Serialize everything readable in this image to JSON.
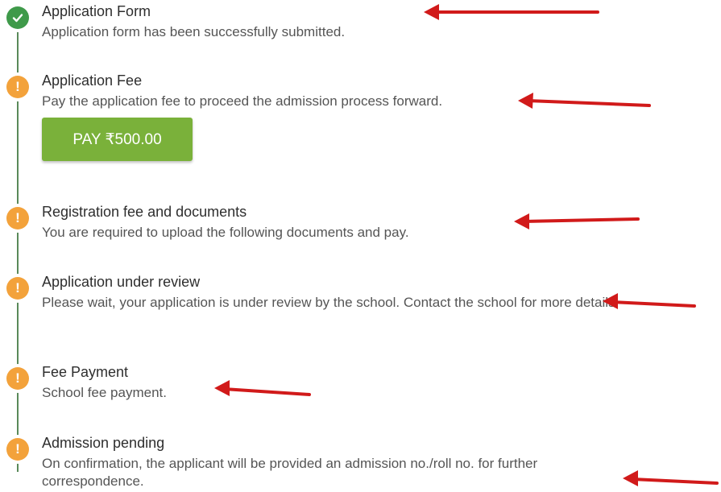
{
  "steps": [
    {
      "status": "done",
      "icon": "check-circle-icon",
      "title": "Application Form",
      "description": "Application form has been successfully submitted."
    },
    {
      "status": "pending",
      "icon": "exclamation-circle-icon",
      "title": "Application Fee",
      "description": "Pay the application fee to proceed the admission process forward."
    },
    {
      "status": "pending",
      "icon": "exclamation-circle-icon",
      "title": "Registration fee and documents",
      "description": "You are required to upload the following documents and pay."
    },
    {
      "status": "pending",
      "icon": "exclamation-circle-icon",
      "title": "Application under review",
      "description": "Please wait, your application is under review by the school. Contact the school for more details."
    },
    {
      "status": "pending",
      "icon": "exclamation-circle-icon",
      "title": "Fee Payment",
      "description": "School fee payment."
    },
    {
      "status": "pending",
      "icon": "exclamation-circle-icon",
      "title": "Admission pending",
      "description": "On confirmation, the applicant will be provided an admission no./roll no. for further correspondence."
    }
  ],
  "pay_button": {
    "label": "PAY ₹500.00"
  },
  "colors": {
    "done": "#3f9a4a",
    "pending": "#f3a23b",
    "pay_button": "#7ab13a",
    "annotation_arrow": "#d11a1a"
  }
}
